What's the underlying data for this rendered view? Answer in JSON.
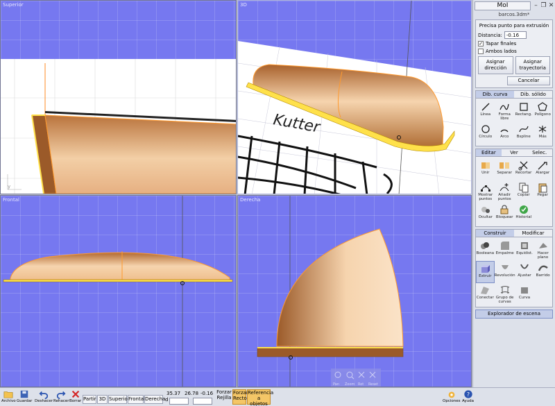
{
  "app": {
    "title": "MoI",
    "file_name": "barcos.3dm*"
  },
  "viewports": {
    "top": "Superior",
    "3d": "3D",
    "front": "Frontal",
    "right": "Derecha",
    "hull_text": "Kutter",
    "view_controls": [
      "Pan",
      "Zoom",
      "Rot",
      "Reset"
    ]
  },
  "command": {
    "prompt": "Precisa punto para extrusión",
    "distance_label": "Distancia:",
    "distance_value": "-0.16",
    "cap_ends": "Tapar finales",
    "both_sides": "Ambos lados",
    "set_direction": "Asignar dirección",
    "set_path": "Asignar trayectoria",
    "cancel": "Cancelar"
  },
  "draw_tabs": [
    "Dib. curva",
    "Dib. sólido"
  ],
  "draw_tools": [
    "Línea",
    "Forma libre",
    "Rectang.",
    "Polígono",
    "Círculo",
    "Arco",
    "Bspline",
    "Más"
  ],
  "edit_tabs": [
    "Editar",
    "Ver",
    "Selec."
  ],
  "edit_tools": [
    "Unir",
    "Separar",
    "Recortar",
    "Alargar",
    "Mostrar puntos",
    "Añadir puntos",
    "Copiar",
    "Pegar",
    "Ocultar",
    "Bloquear",
    "Historial"
  ],
  "construct_tabs": [
    "Construir",
    "Modificar"
  ],
  "construct_tools": [
    "Booleana",
    "Empalme",
    "Equidist.",
    "Hacer plano",
    "Extruir",
    "Revolución",
    "Ajustar",
    "Barrido",
    "Conectar",
    "Grupo de curvas",
    "Curva"
  ],
  "scene_browser": "Explorador de escena",
  "bottom": {
    "file": "Archivo",
    "save": "Guardar",
    "undo": "Deshacer",
    "redo": "Rehacer",
    "delete": "Borrar",
    "views": [
      "Partir",
      "3D",
      "Superior",
      "Frontal",
      "Derecha"
    ],
    "x": "35.37",
    "y": "26.78",
    "z": "-0.16",
    "d_label": "d",
    "force_grid": "Forzar Rejilla",
    "force_straight": "Forzar Recto",
    "object_ref": "Referencia a objetos",
    "options": "Opciones",
    "help": "Ayuda"
  },
  "colors": {
    "viewport_bg": "#7678f0",
    "hull_dark": "#9b5a29",
    "hull_light": "#f6d4ae",
    "highlight": "#ffe14a",
    "edge": "#ff9a2e"
  }
}
